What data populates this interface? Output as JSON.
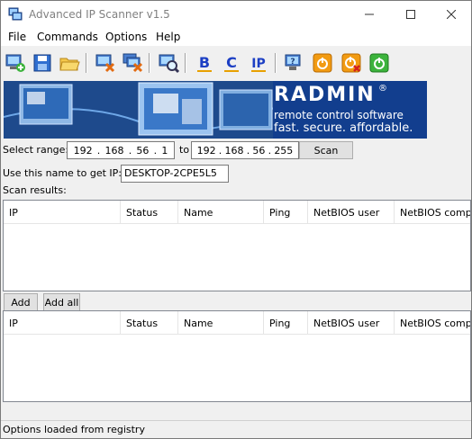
{
  "window": {
    "title": "Advanced IP Scanner v1.5"
  },
  "menu": [
    "File",
    "Commands",
    "Options",
    "Help"
  ],
  "toolbar": {
    "icons": [
      "add-computer-icon",
      "save-icon",
      "open-folder-icon",
      "delete-computer-icon",
      "delete-all-icon",
      "find-computer-icon",
      "class-b-icon",
      "class-c-icon",
      "ip-icon",
      "help-icon",
      "shutdown-icon",
      "abort-shutdown-icon",
      "wake-on-lan-icon"
    ],
    "b_label": "B",
    "c_label": "C",
    "ip_label": "IP"
  },
  "banner": {
    "brand": "RADMIN",
    "registered": "®",
    "subtitle": "remote control software",
    "tagline": "fast. secure. affordable."
  },
  "range": {
    "label": "Select range:",
    "from": [
      "192",
      "168",
      "56",
      "1"
    ],
    "to_label": "to",
    "to": [
      "192",
      "168",
      "56",
      "255"
    ],
    "scan_button": "Scan"
  },
  "name_lookup": {
    "label": "Use this name to get IP:",
    "value": "DESKTOP-2CPE5L5"
  },
  "results": {
    "label": "Scan results:",
    "columns": [
      "IP",
      "Status",
      "Name",
      "Ping",
      "NetBIOS user",
      "NetBIOS comp..."
    ]
  },
  "actions": {
    "add": "Add",
    "add_all": "Add all"
  },
  "favorites": {
    "columns": [
      "IP",
      "Status",
      "Name",
      "Ping",
      "NetBIOS user",
      "NetBIOS comp..."
    ]
  },
  "status": "Options loaded from registry"
}
